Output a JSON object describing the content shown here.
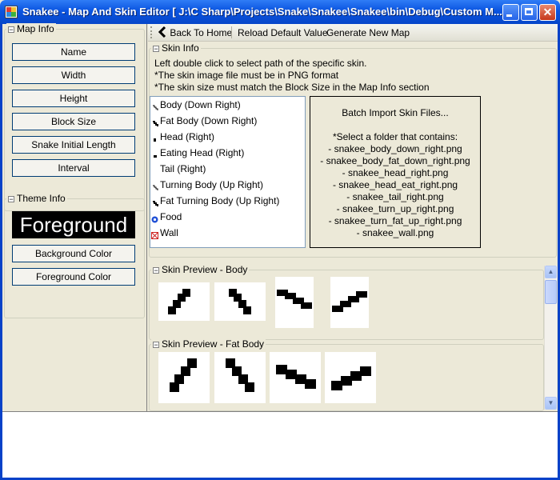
{
  "window": {
    "title": "Snakee - Map And Skin Editor [ J:\\C Sharp\\Projects\\Snake\\Snakee\\Snakee\\bin\\Debug\\Custom M...",
    "minimize_glyph": "_",
    "close_glyph": "✕"
  },
  "map_info": {
    "title": "Map Info",
    "buttons": [
      "Name",
      "Width",
      "Height",
      "Block Size",
      "Snake Initial Length",
      "Interval"
    ]
  },
  "theme_info": {
    "title": "Theme Info",
    "preview_text": "Foreground",
    "background_button": "Background Color",
    "foreground_button": "Foreground Color"
  },
  "toolbar": {
    "back_label": "Back To Home",
    "reload_label": "Reload Default Value",
    "generate_label": "Generate New Map"
  },
  "skin_info": {
    "title": "Skin Info",
    "lines": [
      "Left double click to select path of the specific skin.",
      "*The skin image file must be in PNG format",
      "*The skin size must match the Block Size in the Map Info section"
    ],
    "items": [
      "Body (Down Right)",
      "Fat Body (Down Right)",
      "Head (Right)",
      "Eating Head (Right)",
      "Tail (Right)",
      "Turning Body (Up Right)",
      "Fat Turning Body (Up Right)",
      "Food",
      "Wall"
    ],
    "batch_title": "Batch Import Skin Files...",
    "batch_instruction": "*Select a folder that contains:",
    "batch_files": [
      "- snakee_body_down_right.png",
      "- snakee_body_fat_down_right.png",
      "- snakee_head_right.png",
      "- snakee_head_eat_right.png",
      "- snakee_tail_right.png",
      "- snakee_turn_up_right.png",
      "- snakee_turn_fat_up_right.png",
      "- snakee_wall.png"
    ]
  },
  "preview_body": {
    "title": "Skin Preview - Body"
  },
  "preview_fat": {
    "title": "Skin Preview - Fat Body"
  },
  "colors": {
    "titlebar": "#0a54e0",
    "panel": "#ece9d8",
    "food": "#1f4fd6",
    "wall": "#cc2222"
  }
}
